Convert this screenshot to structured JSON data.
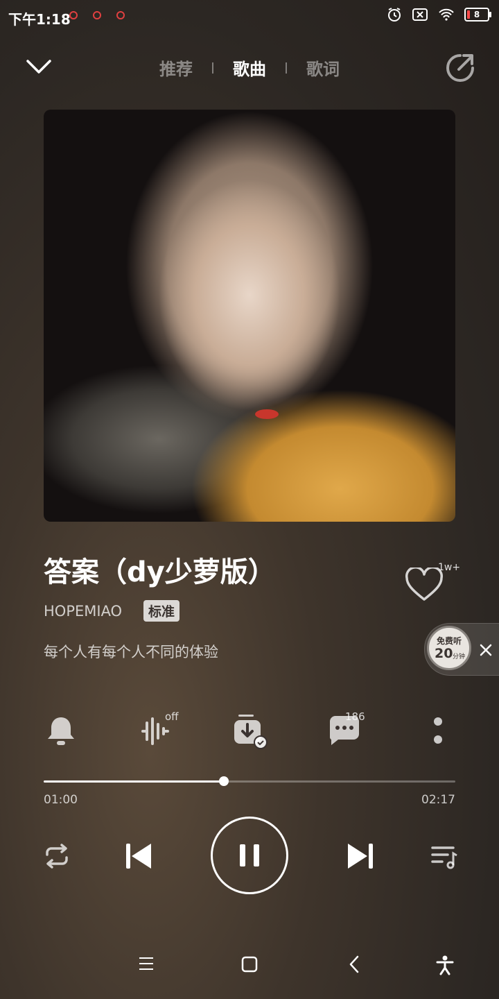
{
  "status_bar": {
    "time": "下午1:18",
    "battery": "8"
  },
  "header": {
    "tabs": [
      "推荐",
      "歌曲",
      "歌词"
    ],
    "active_tab": "歌曲"
  },
  "song": {
    "title": "答案（dy少萝版）",
    "artist": "HOPEMIAO",
    "quality": "标准",
    "subtitle": "每个人有每个人不同的体验",
    "like_count": "1w+"
  },
  "free_listen": {
    "label": "免费听",
    "minutes": "20",
    "unit": "分钟"
  },
  "actions": {
    "effects_badge": "off",
    "comments_count": "186"
  },
  "playback": {
    "current_time": "01:00",
    "total_time": "02:17",
    "progress": 0.438
  },
  "colors": {
    "accent": "#ffffff",
    "battery_low": "#ff4a4a"
  }
}
